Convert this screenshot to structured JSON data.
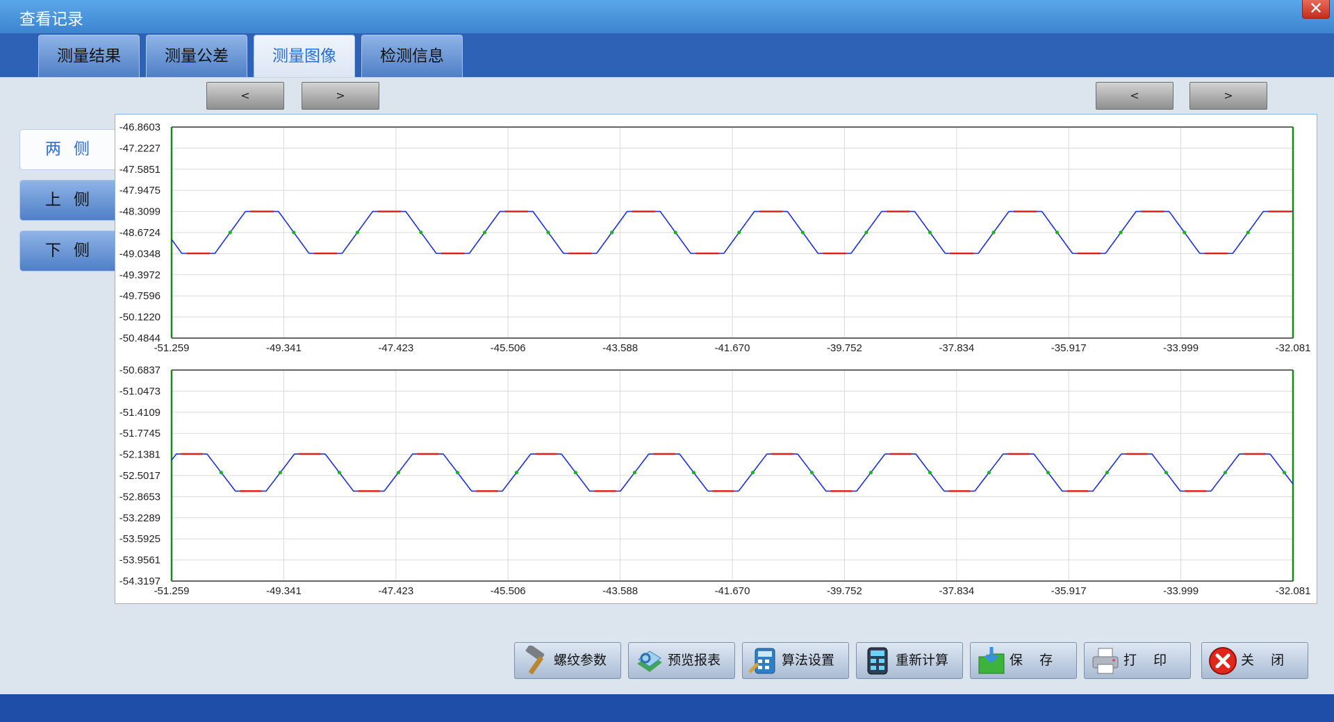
{
  "window": {
    "title": "查看记录"
  },
  "tabs": [
    {
      "label": "测量结果"
    },
    {
      "label": "测量公差"
    },
    {
      "label": "测量图像",
      "active": true
    },
    {
      "label": "检测信息"
    }
  ],
  "nav": {
    "prev": "<",
    "next": ">"
  },
  "side": [
    {
      "label": "两侧",
      "active": true
    },
    {
      "label": "上侧"
    },
    {
      "label": "下侧"
    }
  ],
  "toolbar": [
    {
      "label": "螺纹参数",
      "icon": "hammer-icon"
    },
    {
      "label": "预览报表",
      "icon": "report-icon"
    },
    {
      "label": "算法设置",
      "icon": "calculator-settings-icon"
    },
    {
      "label": "重新计算",
      "icon": "calculator-icon"
    },
    {
      "label": "保    存",
      "icon": "save-folder-icon"
    },
    {
      "label": "打    印",
      "icon": "printer-icon"
    },
    {
      "label": "关    闭",
      "icon": "close-red-icon"
    }
  ],
  "colors": {
    "profile": "#1a2fd6",
    "crest_root": "#e0201a",
    "flank_point": "#19b51e",
    "axis_green": "#128b12"
  },
  "chart_data": [
    {
      "type": "line",
      "title": "",
      "x_ticks": [
        "-51.259",
        "-49.341",
        "-47.423",
        "-45.506",
        "-43.588",
        "-41.670",
        "-39.752",
        "-37.834",
        "-35.917",
        "-33.999",
        "-32.081"
      ],
      "y_ticks": [
        "-46.8603",
        "-47.2227",
        "-47.5851",
        "-47.9475",
        "-48.3099",
        "-48.6724",
        "-49.0348",
        "-49.3972",
        "-49.7596",
        "-50.1220",
        "-50.4844"
      ],
      "xlim": [
        -51.259,
        -32.081
      ],
      "ylim": [
        -50.4844,
        -46.8603
      ],
      "series": [
        {
          "kind": "thread-profile",
          "x_start": -51.259,
          "x_end": -32.081,
          "pitch": 2.176,
          "phase": 0.29,
          "crest": -48.31,
          "root": -49.03,
          "flat_frac": 0.13
        }
      ]
    },
    {
      "type": "line",
      "title": "",
      "x_ticks": [
        "-51.259",
        "-49.341",
        "-47.423",
        "-45.506",
        "-43.588",
        "-41.670",
        "-39.752",
        "-37.834",
        "-35.917",
        "-33.999",
        "-32.081"
      ],
      "y_ticks": [
        "-50.6837",
        "-51.0473",
        "-51.4109",
        "-51.7745",
        "-52.1381",
        "-52.5017",
        "-52.8653",
        "-53.2289",
        "-53.5925",
        "-53.9561",
        "-54.3197"
      ],
      "xlim": [
        -51.259,
        -32.081
      ],
      "ylim": [
        -54.3197,
        -50.6837
      ],
      "series": [
        {
          "kind": "thread-profile",
          "x_start": -51.259,
          "x_end": -32.081,
          "pitch": 2.02,
          "phase": 0.83,
          "crest": -52.13,
          "root": -52.77,
          "flat_frac": 0.13
        }
      ]
    }
  ]
}
